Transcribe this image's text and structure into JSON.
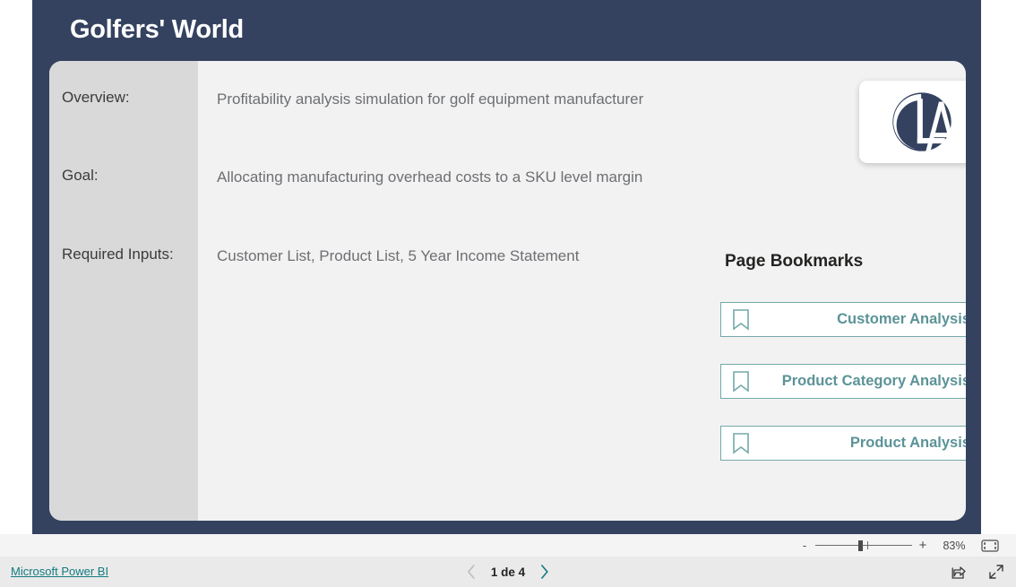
{
  "report": {
    "title": "Golfers' World",
    "rows": [
      {
        "label": "Overview:",
        "value": "Profitability analysis simulation for golf equipment manufacturer"
      },
      {
        "label": "Goal:",
        "value": "Allocating manufacturing overhead costs to a SKU level margin"
      },
      {
        "label": "Required Inputs:",
        "value": "Customer List, Product List, 5 Year Income Statement"
      }
    ],
    "logo_alt": "CLA",
    "bookmarks": {
      "heading": "Page Bookmarks",
      "items": [
        {
          "label": "Customer Analysis",
          "icon": "bookmark-icon"
        },
        {
          "label": "Product Category Analysis",
          "icon": "bookmark-icon"
        },
        {
          "label": "Product Analysis",
          "icon": "bookmark-icon"
        }
      ]
    }
  },
  "toolbar": {
    "zoom_out_label": "-",
    "zoom_in_label": "+",
    "zoom_value": "83%",
    "fit_icon": "fit-to-screen-icon"
  },
  "bottom_bar": {
    "brand_link": "Microsoft Power BI",
    "page_indicator": "1 de 4",
    "prev_icon": "chevron-left-icon",
    "next_icon": "chevron-right-icon",
    "share_icon": "share-icon",
    "fullscreen_icon": "fullscreen-icon"
  },
  "colors": {
    "canvas": "#344260",
    "card": "#f2f2f2",
    "label_column": "#d9d9d9",
    "accent_teal": "#5b9397",
    "link_teal": "#137b80"
  }
}
